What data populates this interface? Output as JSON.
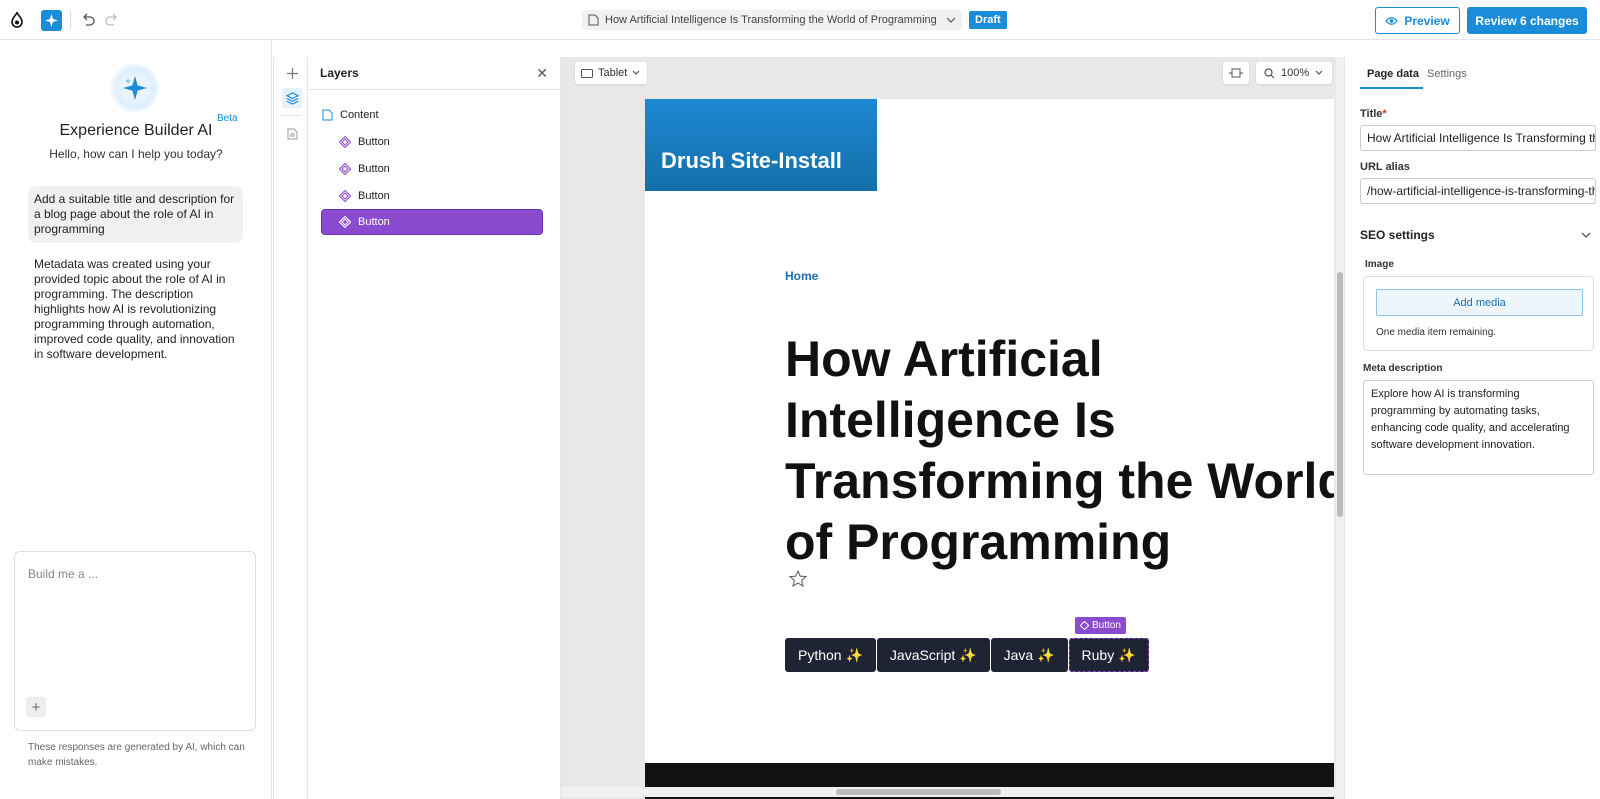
{
  "topbar": {
    "page_title": "How Artificial Intelligence Is Transforming the World of Programming",
    "status_badge": "Draft",
    "preview_label": "Preview",
    "review_label": "Review 6 changes",
    "accent_color": "#1a8cd8"
  },
  "ai": {
    "title": "Experience Builder AI",
    "beta": "Beta",
    "greeting": "Hello, how can I help you today?",
    "user_message": "Add a suitable title and description for a blog page about the role of AI in programming",
    "assistant_reply": "Metadata was created using your provided topic about the role of AI in programming. The description highlights how AI is revolutionizing programming through automation, improved code quality, and innovation in software development.",
    "input_placeholder": "Build me a ...",
    "disclaimer": "These responses are generated by AI, which can make mistakes."
  },
  "layers": {
    "title": "Layers",
    "items": [
      {
        "label": "Content",
        "icon": "page-icon"
      },
      {
        "label": "Button",
        "icon": "component-icon"
      },
      {
        "label": "Button",
        "icon": "component-icon"
      },
      {
        "label": "Button",
        "icon": "component-icon"
      },
      {
        "label": "Button",
        "icon": "component-icon",
        "selected": true
      }
    ]
  },
  "canvas": {
    "device": "Tablet",
    "zoom": "100%",
    "site_name": "Drush Site-Install",
    "breadcrumb": "Home",
    "heading_lines": [
      "How Artificial",
      "Intelligence Is",
      "Transforming the World",
      "of Programming"
    ],
    "selection_tag": "Button",
    "buttons": [
      "Python ✨",
      "JavaScript ✨",
      "Java ✨",
      "Ruby ✨"
    ],
    "selection_color": "#8b4bd1"
  },
  "props": {
    "tabs": [
      "Page data",
      "Settings"
    ],
    "title_label": "Title",
    "title_value": "How Artificial Intelligence Is Transforming the World of Programming",
    "url_label": "URL alias",
    "url_value": "/how-artificial-intelligence-is-transforming-the-world-of-programming",
    "seo_heading": "SEO settings",
    "image_label": "Image",
    "add_media": "Add media",
    "media_hint": "One media item remaining.",
    "meta_label": "Meta description",
    "meta_value": "Explore how AI is transforming programming by automating tasks, enhancing code quality, and accelerating software development innovation."
  }
}
